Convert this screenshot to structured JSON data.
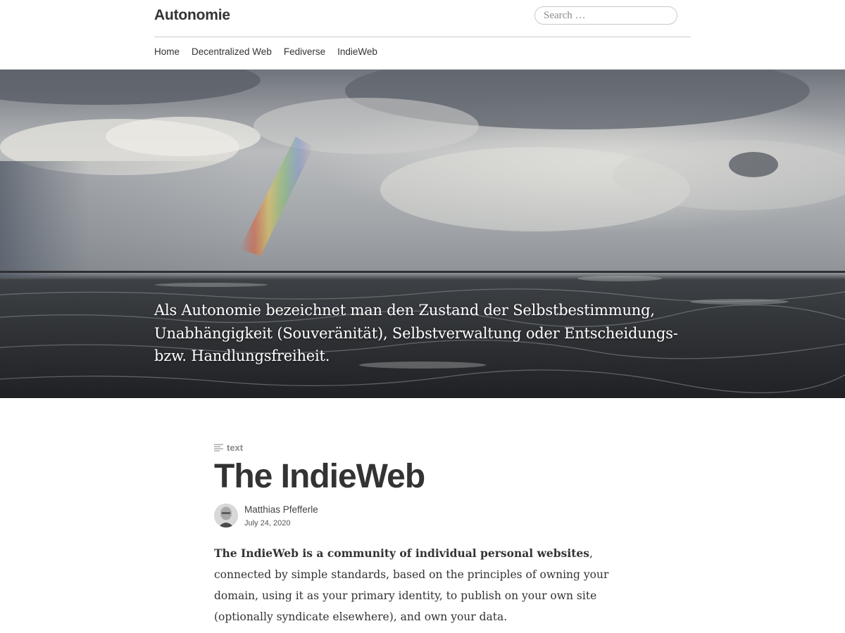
{
  "header": {
    "site_title": "Autonomie",
    "search_placeholder": "Search …",
    "search_value": ""
  },
  "nav": {
    "items": [
      {
        "label": "Home"
      },
      {
        "label": "Decentralized Web"
      },
      {
        "label": "Fediverse"
      },
      {
        "label": "IndieWeb"
      }
    ]
  },
  "hero": {
    "description": "Als Autonomie bezeichnet man den Zustand der Selbstbestimmung, Unabhängigkeit (Souveränität), Selbstverwaltung oder Entscheidungs- bzw. Handlungsfreiheit."
  },
  "post": {
    "format_label": "text",
    "format_icon": "text-lines-icon",
    "title": "The IndieWeb",
    "author": "Matthias Pfefferle",
    "date": "July 24, 2020",
    "intro_bold": "The IndieWeb is a community of individual personal websites",
    "intro_rest": ", connected by simple standards, based on the principles of owning your domain, using it as your primary identity, to publish on your own site (optionally syndicate elsewhere), and own your data."
  },
  "colors": {
    "text": "#333333",
    "muted": "#8a8a8a",
    "border": "#cccccc"
  }
}
